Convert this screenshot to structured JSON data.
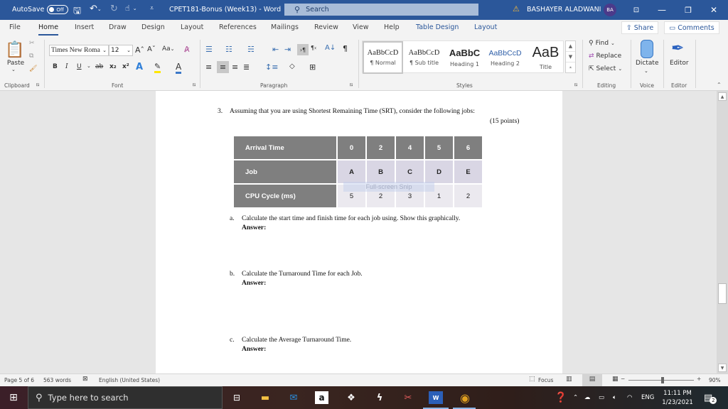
{
  "titlebar": {
    "autosave_label": "AutoSave",
    "autosave_state": "Off",
    "document_title": "CPET181-Bonus (Week13)  -  Word",
    "search_placeholder": "Search",
    "user_name": "BASHAYER ALADWANI",
    "user_initials": "BA",
    "icons": [
      "save-icon",
      "undo-icon",
      "redo-icon",
      "touch-mode-icon",
      "customize-qat-icon",
      "warning-icon",
      "ribbon-display-icon",
      "minimize-icon",
      "restore-icon",
      "close-icon"
    ]
  },
  "tabs": [
    {
      "label": "File"
    },
    {
      "label": "Home",
      "active": true
    },
    {
      "label": "Insert"
    },
    {
      "label": "Draw"
    },
    {
      "label": "Design"
    },
    {
      "label": "Layout"
    },
    {
      "label": "References"
    },
    {
      "label": "Mailings"
    },
    {
      "label": "Review"
    },
    {
      "label": "View"
    },
    {
      "label": "Help"
    },
    {
      "label": "Table Design",
      "contextual": true
    },
    {
      "label": "Layout",
      "contextual": true
    }
  ],
  "share_label": "Share",
  "comments_label": "Comments",
  "ribbon": {
    "clipboard": {
      "paste_label": "Paste",
      "group_label": "Clipboard"
    },
    "font": {
      "font_name": "Times New Roma",
      "font_size": "12",
      "change_case": "Aa",
      "bold": "B",
      "italic": "I",
      "underline": "U",
      "strikethrough": "ab",
      "subscript": "x₂",
      "superscript": "x²",
      "group_label": "Font"
    },
    "paragraph": {
      "group_label": "Paragraph"
    },
    "styles": {
      "group_label": "Styles",
      "items": [
        {
          "sample": "AaBbCcD",
          "name": "¶ Normal",
          "selected": true
        },
        {
          "sample": "AaBbCcD",
          "name": "¶ Sub title"
        },
        {
          "sample": "AaBbC",
          "name": "Heading 1"
        },
        {
          "sample": "AaBbCcD",
          "name": "Heading 2"
        },
        {
          "sample": "AaB",
          "name": "Title"
        }
      ]
    },
    "editing": {
      "find_label": "Find",
      "replace_label": "Replace",
      "select_label": "Select",
      "group_label": "Editing"
    },
    "voice": {
      "dictate_label": "Dictate",
      "group_label": "Voice"
    },
    "editor": {
      "editor_label": "Editor",
      "group_label": "Editor"
    }
  },
  "document": {
    "question_number": "3.",
    "question_text": "Assuming that you are using Shortest Remaining Time (SRT), consider the following jobs:",
    "points": "(15 points)",
    "table": {
      "rows": [
        {
          "header": "Arrival Time",
          "cells": [
            "0",
            "2",
            "4",
            "5",
            "6"
          ]
        },
        {
          "header": "Job",
          "cells": [
            "A",
            "B",
            "C",
            "D",
            "E"
          ]
        },
        {
          "header": "CPU Cycle (ms)",
          "cells": [
            "5",
            "2",
            "3",
            "1",
            "2"
          ]
        }
      ]
    },
    "snip_overlay": "Full-screen Snip",
    "parts": [
      {
        "marker": "a.",
        "text": "Calculate the start time and finish time for each job using. Show this graphically.",
        "answer_label": "Answer:"
      },
      {
        "marker": "b.",
        "text": "Calculate the Turnaround Time for each Job.",
        "answer_label": "Answer:"
      },
      {
        "marker": "c.",
        "text": "Calculate the Average Turnaround Time.",
        "answer_label": "Answer:"
      }
    ]
  },
  "statusbar": {
    "page": "Page 5 of 6",
    "words": "563 words",
    "language": "English (United States)",
    "focus_label": "Focus",
    "zoom_minus": "−",
    "zoom_plus": "+",
    "zoom_level": "90%"
  },
  "taskbar": {
    "search_placeholder": "Type here to search",
    "apps": [
      "task-view",
      "file-explorer",
      "mail",
      "amazon",
      "dropbox",
      "app-s",
      "snipping-tool",
      "word",
      "chrome"
    ],
    "language": "ENG",
    "time": "11:11 PM",
    "date": "1/23/2021",
    "notifications": "2"
  }
}
